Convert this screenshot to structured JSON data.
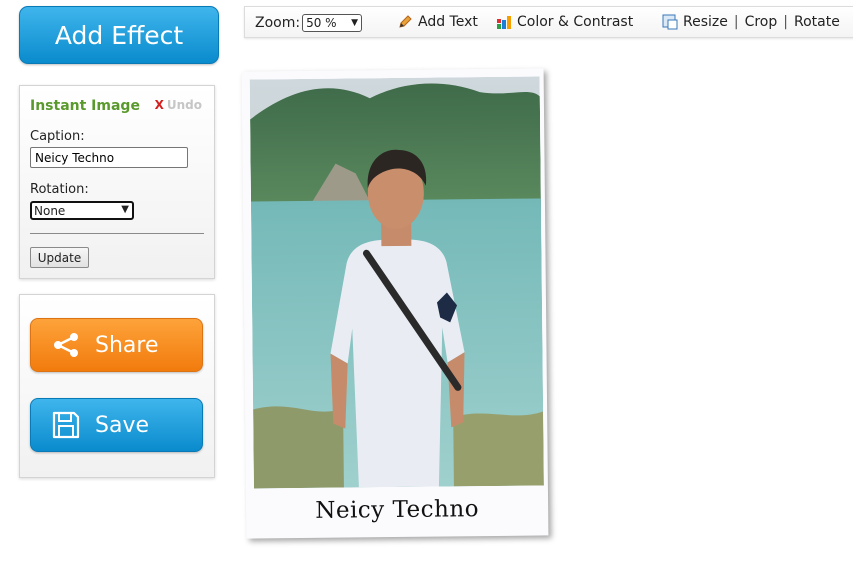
{
  "add_effect": {
    "label": "Add Effect"
  },
  "effect_panel": {
    "title": "Instant Image",
    "undo_x": "X",
    "undo_label": "Undo",
    "caption_label": "Caption:",
    "caption_value": "Neicy Techno",
    "rotation_label": "Rotation:",
    "rotation_value": "None",
    "update_label": "Update"
  },
  "actions": {
    "share_label": "Share",
    "save_label": "Save"
  },
  "toolbar": {
    "zoom_label": "Zoom:",
    "zoom_value": "50 %",
    "add_text": "Add Text",
    "color_contrast": "Color & Contrast",
    "resize": "Resize",
    "crop": "Crop",
    "rotate": "Rotate",
    "separator": "|"
  },
  "photo": {
    "caption": "Neicy Techno"
  },
  "colors": {
    "accent_blue": "#0a8bcd",
    "share_orange": "#f27b0d",
    "panel_title_green": "#5a9a2d",
    "undo_red": "#d42020"
  }
}
